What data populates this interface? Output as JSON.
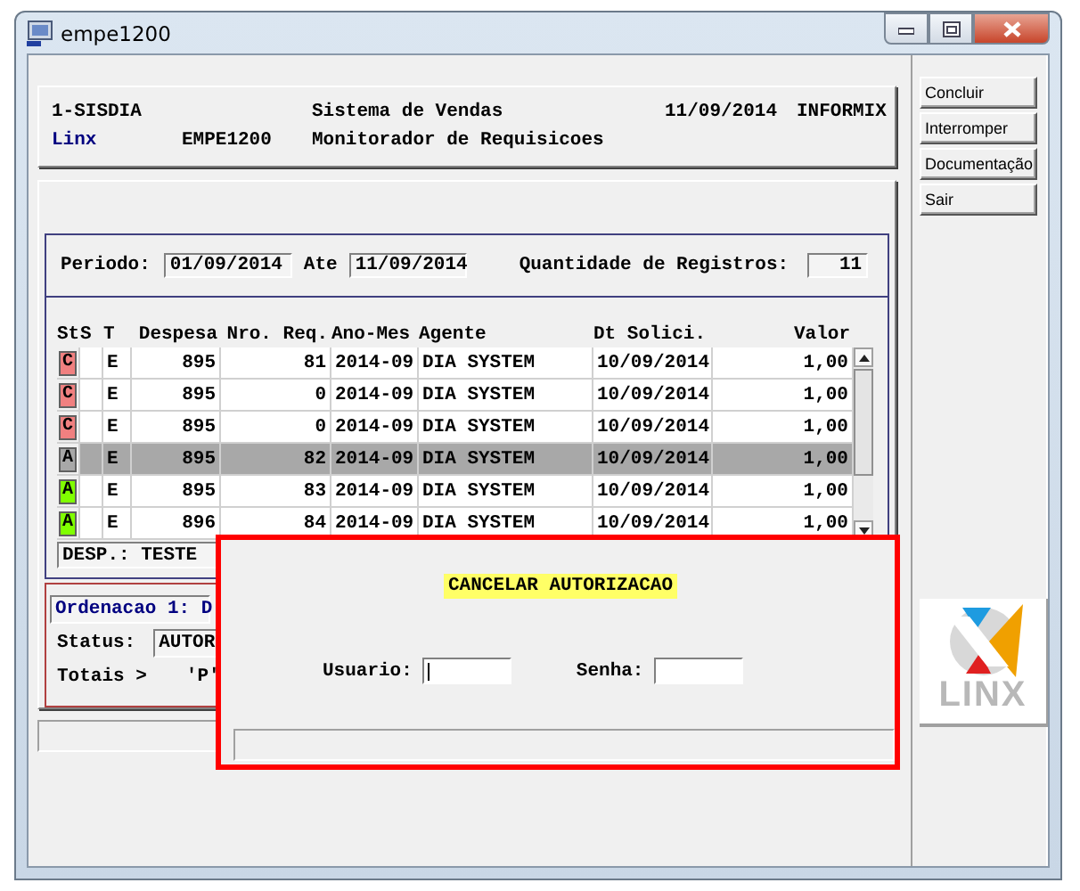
{
  "window": {
    "title": "empe1200"
  },
  "header": {
    "system": "1-SISDIA",
    "system_name": "Sistema de Vendas",
    "date": "11/09/2014",
    "database": "INFORMIX",
    "company": "Linx",
    "program": "EMPE1200",
    "program_name": "Monitorador de Requisicoes"
  },
  "filter": {
    "period_label": "Periodo:",
    "period_from": "01/09/2014",
    "until_label": "Ate",
    "period_to": "11/09/2014",
    "count_label": "Quantidade de Registros:",
    "count": "11"
  },
  "table": {
    "columns": [
      "St",
      "S",
      "T",
      "Despesa",
      "Nro. Req.",
      "Ano-Mes",
      "Agente",
      "Dt Solici.",
      "Valor"
    ],
    "rows": [
      {
        "st": "C",
        "color": "#f08080",
        "t": "E",
        "despesa": "895",
        "nro_req": "81",
        "ano_mes": "2014-09",
        "agente": "DIA SYSTEM",
        "dt_solici": "10/09/2014",
        "valor": "1,00",
        "selected": false
      },
      {
        "st": "C",
        "color": "#f08080",
        "t": "E",
        "despesa": "895",
        "nro_req": "0",
        "ano_mes": "2014-09",
        "agente": "DIA SYSTEM",
        "dt_solici": "10/09/2014",
        "valor": "1,00",
        "selected": false
      },
      {
        "st": "C",
        "color": "#f08080",
        "t": "E",
        "despesa": "895",
        "nro_req": "0",
        "ano_mes": "2014-09",
        "agente": "DIA SYSTEM",
        "dt_solici": "10/09/2014",
        "valor": "1,00",
        "selected": false
      },
      {
        "st": "A",
        "color": "#a8a8a8",
        "t": "E",
        "despesa": "895",
        "nro_req": "82",
        "ano_mes": "2014-09",
        "agente": "DIA SYSTEM",
        "dt_solici": "10/09/2014",
        "valor": "1,00",
        "selected": true
      },
      {
        "st": "A",
        "color": "#80ff00",
        "t": "E",
        "despesa": "895",
        "nro_req": "83",
        "ano_mes": "2014-09",
        "agente": "DIA SYSTEM",
        "dt_solici": "10/09/2014",
        "valor": "1,00",
        "selected": false
      },
      {
        "st": "A",
        "color": "#80ff00",
        "t": "E",
        "despesa": "896",
        "nro_req": "84",
        "ano_mes": "2014-09",
        "agente": "DIA SYSTEM",
        "dt_solici": "10/09/2014",
        "valor": "1,00",
        "selected": false
      }
    ]
  },
  "description": "DESP.: TESTE",
  "ordering": {
    "label": "Ordenacao 1: D",
    "status_label": "Status:",
    "status_value": "AUTOR",
    "totals_label": "Totais >",
    "totals_value": "'P'"
  },
  "dialog": {
    "title": "CANCELAR AUTORIZACAO",
    "user_label": "Usuario:",
    "password_label": "Senha:"
  },
  "buttons": [
    "Concluir",
    "Interromper",
    "Documentação",
    "Sair"
  ],
  "logo": {
    "text": "LINX"
  }
}
